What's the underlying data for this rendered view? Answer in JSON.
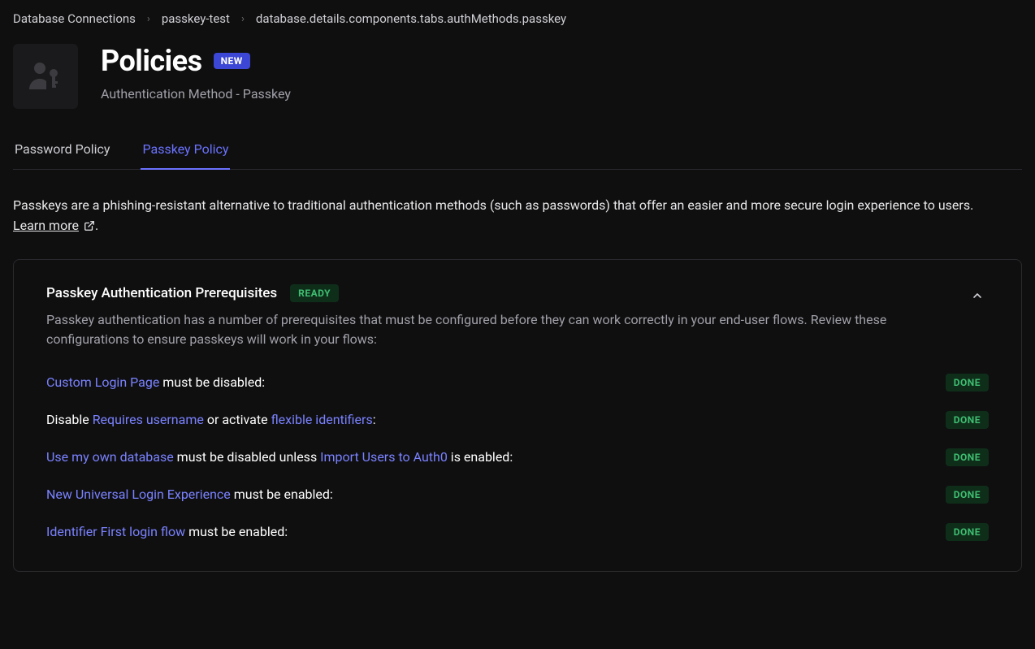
{
  "breadcrumb": {
    "items": [
      "Database Connections",
      "passkey-test",
      "database.details.components.tabs.authMethods.passkey"
    ]
  },
  "header": {
    "title": "Policies",
    "badge": "NEW",
    "subtitle": "Authentication Method - Passkey"
  },
  "tabs": {
    "items": [
      {
        "label": "Password Policy",
        "active": false
      },
      {
        "label": "Passkey Policy",
        "active": true
      }
    ]
  },
  "intro": {
    "text": "Passkeys are a phishing-resistant alternative to traditional authentication methods (such as passwords) that offer an easier and more secure login experience to users. ",
    "learn_more": "Learn more",
    "period": "."
  },
  "card": {
    "title": "Passkey Authentication Prerequisites",
    "status": "READY",
    "description": "Passkey authentication has a number of prerequisites that must be configured before they can work correctly in your end-user flows. Review these configurations to ensure passkeys will work in your flows:"
  },
  "prereqs": [
    {
      "parts": [
        {
          "t": "link",
          "v": "Custom Login Page"
        },
        {
          "t": "text",
          "v": " must be disabled:"
        }
      ],
      "status": "DONE"
    },
    {
      "parts": [
        {
          "t": "text",
          "v": "Disable "
        },
        {
          "t": "link",
          "v": "Requires username"
        },
        {
          "t": "text",
          "v": " or activate "
        },
        {
          "t": "link",
          "v": "flexible identifiers"
        },
        {
          "t": "text",
          "v": ":"
        }
      ],
      "status": "DONE"
    },
    {
      "parts": [
        {
          "t": "link",
          "v": "Use my own database"
        },
        {
          "t": "text",
          "v": " must be disabled unless "
        },
        {
          "t": "link",
          "v": "Import Users to Auth0"
        },
        {
          "t": "text",
          "v": " is enabled:"
        }
      ],
      "status": "DONE"
    },
    {
      "parts": [
        {
          "t": "link",
          "v": "New Universal Login Experience"
        },
        {
          "t": "text",
          "v": " must be enabled:"
        }
      ],
      "status": "DONE"
    },
    {
      "parts": [
        {
          "t": "link",
          "v": "Identifier First login flow"
        },
        {
          "t": "text",
          "v": " must be enabled:"
        }
      ],
      "status": "DONE"
    }
  ]
}
